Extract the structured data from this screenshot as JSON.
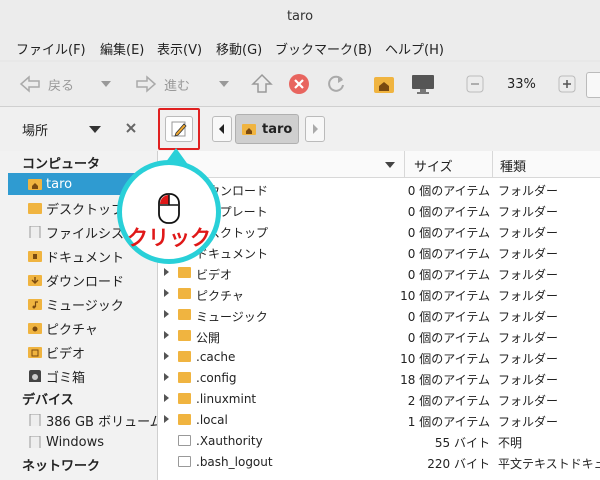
{
  "window": {
    "title": "taro"
  },
  "menu": [
    "ファイル(F)",
    "編集(E)",
    "表示(V)",
    "移動(G)",
    "ブックマーク(B)",
    "ヘルプ(H)"
  ],
  "toolbar": {
    "back_label": "戻る",
    "forward_label": "進む",
    "zoom": "33%"
  },
  "location": {
    "places_label": "場所",
    "crumb": "taro"
  },
  "sidebar": {
    "computer_heading": "コンピュータ",
    "items": [
      "taro",
      "デスクトップ",
      "ファイルシステム",
      "ドキュメント",
      "ダウンロード",
      "ミュージック",
      "ピクチャ",
      "ビデオ",
      "ゴミ箱"
    ],
    "devices_heading": "デバイス",
    "devices": [
      "386 GB ボリューム",
      "Windows"
    ],
    "network_heading": "ネットワーク"
  },
  "columns": {
    "size": "サイズ",
    "kind": "種類"
  },
  "files": [
    {
      "name": "ダウンロード",
      "size": "0 個のアイテム",
      "kind": "フォルダー"
    },
    {
      "name": "テンプレート",
      "size": "0 個のアイテム",
      "kind": "フォルダー"
    },
    {
      "name": "デスクトップ",
      "size": "0 個のアイテム",
      "kind": "フォルダー"
    },
    {
      "name": "ドキュメント",
      "size": "0 個のアイテム",
      "kind": "フォルダー"
    },
    {
      "name": "ビデオ",
      "size": "0 個のアイテム",
      "kind": "フォルダー"
    },
    {
      "name": "ピクチャ",
      "size": "10 個のアイテム",
      "kind": "フォルダー"
    },
    {
      "name": "ミュージック",
      "size": "0 個のアイテム",
      "kind": "フォルダー"
    },
    {
      "name": "公開",
      "size": "0 個のアイテム",
      "kind": "フォルダー"
    },
    {
      "name": ".cache",
      "size": "10 個のアイテム",
      "kind": "フォルダー"
    },
    {
      "name": ".config",
      "size": "18 個のアイテム",
      "kind": "フォルダー"
    },
    {
      "name": ".linuxmint",
      "size": "2 個のアイテム",
      "kind": "フォルダー"
    },
    {
      "name": ".local",
      "size": "1 個のアイテム",
      "kind": "フォルダー"
    },
    {
      "name": ".Xauthority",
      "size": "55 バイト",
      "kind": "不明"
    },
    {
      "name": ".bash_logout",
      "size": "220 バイト",
      "kind": "平文テキストドキュメント"
    }
  ],
  "callout": {
    "text": "クリック"
  },
  "colors": {
    "selection": "#2f9bd1",
    "folder": "#f0b440",
    "callout_ring": "#29d0d8",
    "callout_text": "#e01818",
    "highlight_box": "#e02020"
  }
}
